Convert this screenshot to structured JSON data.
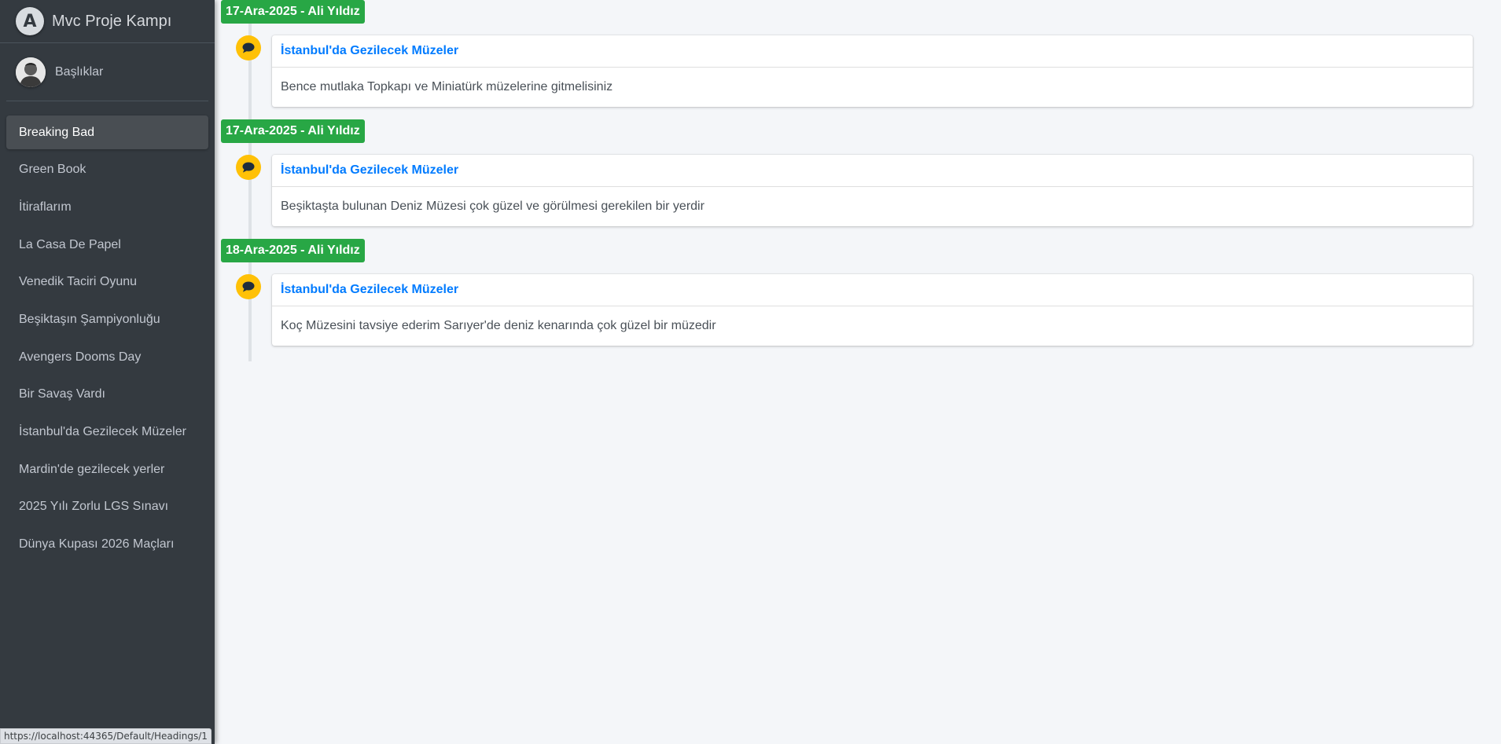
{
  "brand": {
    "logo_letter": "A",
    "title": "Mvc Proje Kampı"
  },
  "user": {
    "name": "Başlıklar"
  },
  "sidebar": {
    "items": [
      {
        "label": "Breaking Bad",
        "active": true
      },
      {
        "label": "Green Book"
      },
      {
        "label": "İtiraflarım"
      },
      {
        "label": "La Casa De Papel"
      },
      {
        "label": "Venedik Taciri Oyunu"
      },
      {
        "label": "Beşiktaşın Şampiyonluğu"
      },
      {
        "label": "Avengers Dooms Day"
      },
      {
        "label": "Bir Savaş Vardı"
      },
      {
        "label": "İstanbul'da Gezilecek Müzeler"
      },
      {
        "label": "Mardin'de gezilecek yerler"
      },
      {
        "label": "2025 Yılı Zorlu LGS Sınavı"
      },
      {
        "label": "Dünya Kupası 2026 Maçları"
      }
    ]
  },
  "timeline": [
    {
      "label": "17-Ara-2025 - Ali Yıldız",
      "title": "İstanbul'da Gezilecek Müzeler",
      "body": "Bence mutlaka Topkapı ve Miniatürk müzelerine gitmelisiniz"
    },
    {
      "label": "17-Ara-2025 - Ali Yıldız",
      "title": "İstanbul'da Gezilecek Müzeler",
      "body": "Beşiktaşta bulunan Deniz Müzesi çok güzel ve görülmesi gerekilen bir yerdir"
    },
    {
      "label": "18-Ara-2025 - Ali Yıldız",
      "title": "İstanbul'da Gezilecek Müzeler",
      "body": "Koç Müzesini tavsiye ederim Sarıyer'de deniz kenarında çok güzel bir müzedir"
    }
  ],
  "status_bar": {
    "url": "https://localhost:44365/Default/Headings/1"
  },
  "colors": {
    "sidebar_bg": "#343a40",
    "label_green": "#28a745",
    "icon_yellow": "#ffc107",
    "link_blue": "#007bff"
  },
  "icons": {
    "entry_icon": "comment-icon"
  }
}
